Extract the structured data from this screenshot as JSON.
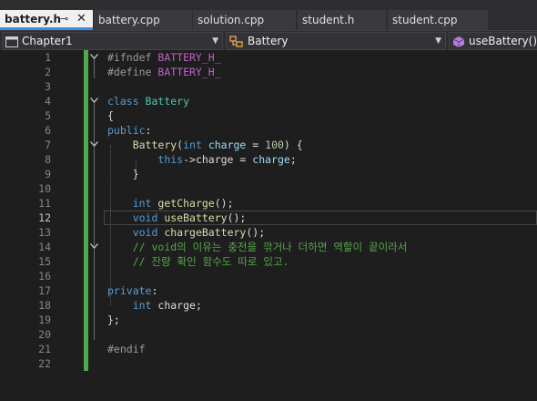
{
  "tabs": [
    {
      "label": "battery.h",
      "active": true
    },
    {
      "label": "battery.cpp"
    },
    {
      "label": "solution.cpp"
    },
    {
      "label": "student.h"
    },
    {
      "label": "student.cpp"
    }
  ],
  "navbar": {
    "project": "Chapter1",
    "scope": "Battery",
    "member": "useBattery()"
  },
  "editor": {
    "current_line": 12,
    "lines": [
      {
        "n": "1",
        "fold": true,
        "tokens": [
          [
            "pp",
            "#ifndef "
          ],
          [
            "mac",
            "BATTERY_H_"
          ]
        ]
      },
      {
        "n": "2",
        "tokens": [
          [
            "pp",
            "#define "
          ],
          [
            "mac",
            "BATTERY_H_"
          ]
        ]
      },
      {
        "n": "3",
        "tokens": []
      },
      {
        "n": "4",
        "fold": true,
        "tokens": [
          [
            "kw",
            "class "
          ],
          [
            "cls",
            "Battery"
          ]
        ]
      },
      {
        "n": "5",
        "tokens": [
          [
            "pl",
            "{"
          ]
        ]
      },
      {
        "n": "6",
        "tokens": [
          [
            "kw",
            "public"
          ],
          [
            "pl",
            ":"
          ]
        ]
      },
      {
        "n": "7",
        "fold": true,
        "tokens": [
          [
            "pl",
            "    "
          ],
          [
            "fn",
            "Battery"
          ],
          [
            "pl",
            "("
          ],
          [
            "kw",
            "int "
          ],
          [
            "prm",
            "charge"
          ],
          [
            "pl",
            " = "
          ],
          [
            "num",
            "100"
          ],
          [
            "pl",
            ") {"
          ]
        ]
      },
      {
        "n": "8",
        "tokens": [
          [
            "pl",
            "        "
          ],
          [
            "kw",
            "this"
          ],
          [
            "pl",
            "->charge = "
          ],
          [
            "prm",
            "charge"
          ],
          [
            "pl",
            ";"
          ]
        ]
      },
      {
        "n": "9",
        "tokens": [
          [
            "pl",
            "    }"
          ]
        ]
      },
      {
        "n": "10",
        "tokens": []
      },
      {
        "n": "11",
        "tokens": [
          [
            "pl",
            "    "
          ],
          [
            "kw",
            "int "
          ],
          [
            "fn",
            "getCharge"
          ],
          [
            "pl",
            "();"
          ]
        ]
      },
      {
        "n": "12",
        "tokens": [
          [
            "pl",
            "    "
          ],
          [
            "kw",
            "void "
          ],
          [
            "fn",
            "useBattery"
          ],
          [
            "pl",
            "();"
          ]
        ]
      },
      {
        "n": "13",
        "tokens": [
          [
            "pl",
            "    "
          ],
          [
            "kw",
            "void "
          ],
          [
            "fn",
            "chargeBattery"
          ],
          [
            "pl",
            "();"
          ]
        ]
      },
      {
        "n": "14",
        "fold": true,
        "tokens": [
          [
            "pl",
            "    "
          ],
          [
            "cmt",
            "// void의 이유는 충전을 깎거나 더하면 역할이 끝이라서"
          ]
        ]
      },
      {
        "n": "15",
        "tokens": [
          [
            "pl",
            "    "
          ],
          [
            "cmt",
            "// 잔량 확인 함수도 따로 있고."
          ]
        ]
      },
      {
        "n": "16",
        "tokens": []
      },
      {
        "n": "17",
        "tokens": [
          [
            "kw",
            "private"
          ],
          [
            "pl",
            ":"
          ]
        ]
      },
      {
        "n": "18",
        "tokens": [
          [
            "pl",
            "    "
          ],
          [
            "kw",
            "int "
          ],
          [
            "pl",
            "charge;"
          ]
        ]
      },
      {
        "n": "19",
        "tokens": [
          [
            "pl",
            "};"
          ]
        ]
      },
      {
        "n": "20",
        "tokens": []
      },
      {
        "n": "21",
        "tokens": [
          [
            "pp",
            "#endif"
          ]
        ]
      },
      {
        "n": "22",
        "tokens": []
      }
    ]
  }
}
